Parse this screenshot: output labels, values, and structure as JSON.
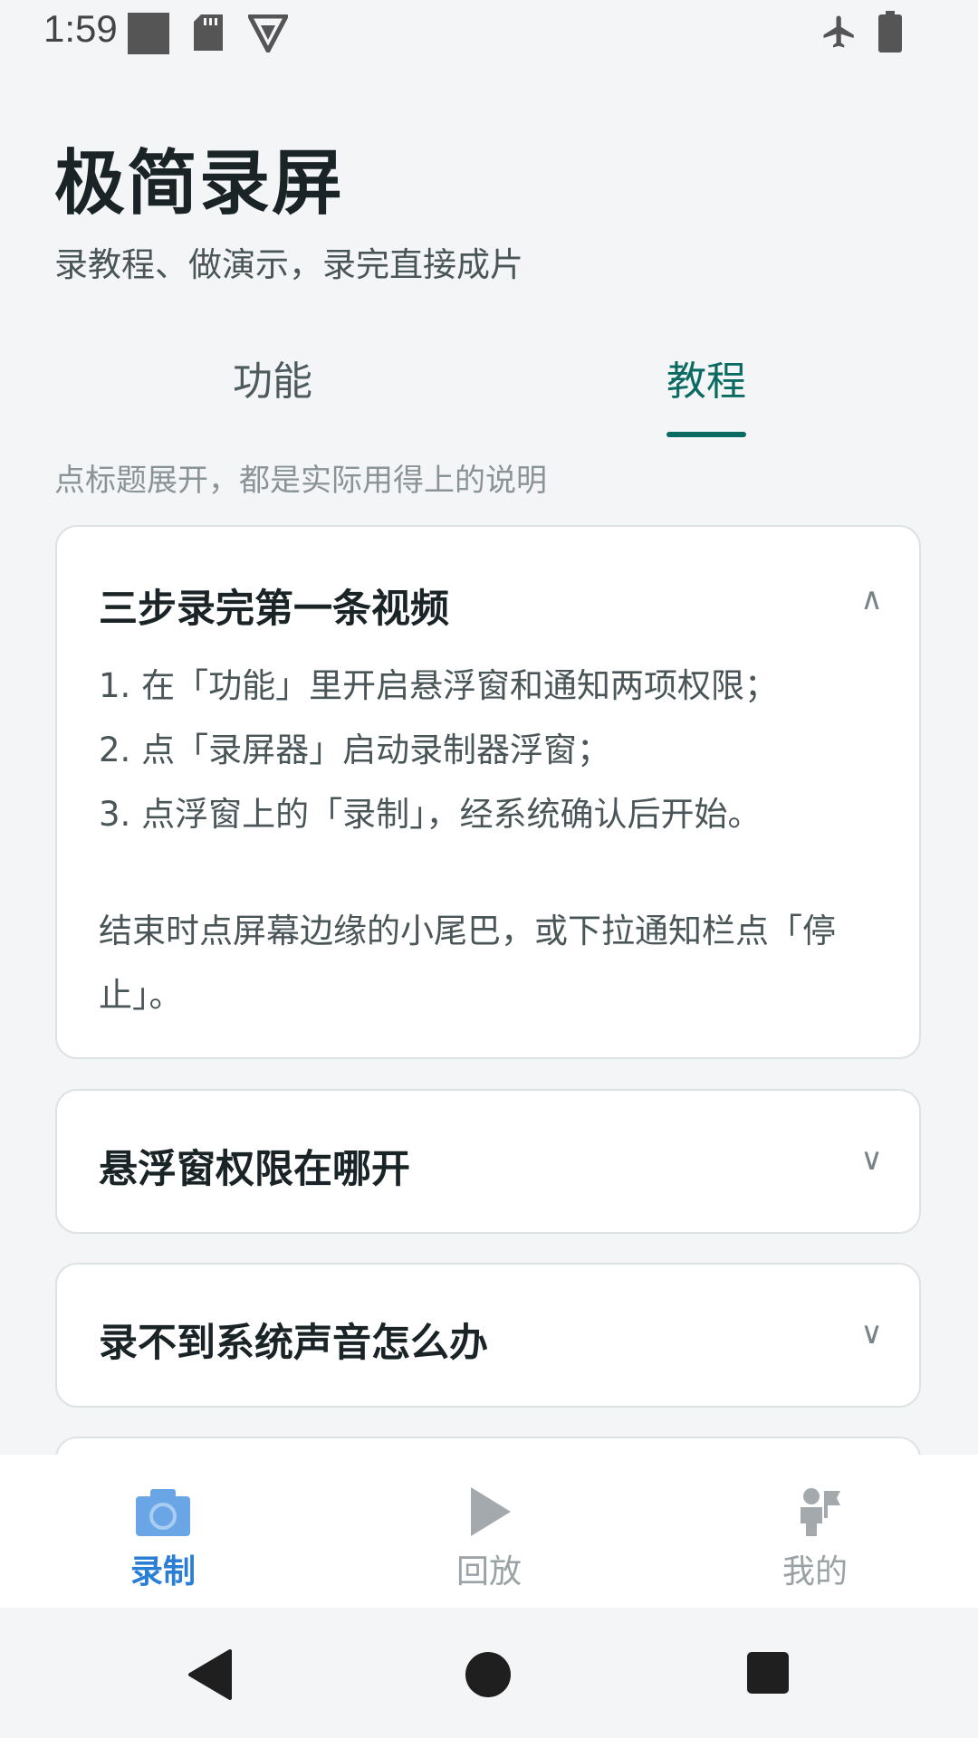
{
  "status_bar": {
    "time": "1:59",
    "icons": [
      "square-icon",
      "sd-card-icon",
      "vpn-icon",
      "airplane-icon",
      "battery-icon"
    ]
  },
  "header": {
    "title": "极简录屏",
    "subtitle": "录教程、做演示，录完直接成片"
  },
  "tabs": [
    {
      "label": "功能",
      "active": false
    },
    {
      "label": "教程",
      "active": true
    }
  ],
  "hint": "点标题展开，都是实际用得上的说明",
  "faq": [
    {
      "title": "三步录完第一条视频",
      "expanded": true,
      "chevron": "∧",
      "lines": [
        "1. 在「功能」里开启悬浮窗和通知两项权限；",
        "2. 点「录屏器」启动录制器浮窗；",
        "3. 点浮窗上的「录制」，经系统确认后开始。"
      ],
      "footer": "结束时点屏幕边缘的小尾巴，或下拉通知栏点「停止」。"
    },
    {
      "title": "悬浮窗权限在哪开",
      "expanded": false,
      "chevron": "∨"
    },
    {
      "title": "录不到系统声音怎么办",
      "expanded": false,
      "chevron": "∨"
    }
  ],
  "bottom_nav": [
    {
      "label": "录制",
      "icon": "camera-icon",
      "active": true
    },
    {
      "label": "回放",
      "icon": "play-icon",
      "active": false
    },
    {
      "label": "我的",
      "icon": "person-icon",
      "active": false
    }
  ],
  "colors": {
    "accent": "#0b6b62",
    "nav_active": "#2a7fd4",
    "background": "#f4f5f7"
  }
}
